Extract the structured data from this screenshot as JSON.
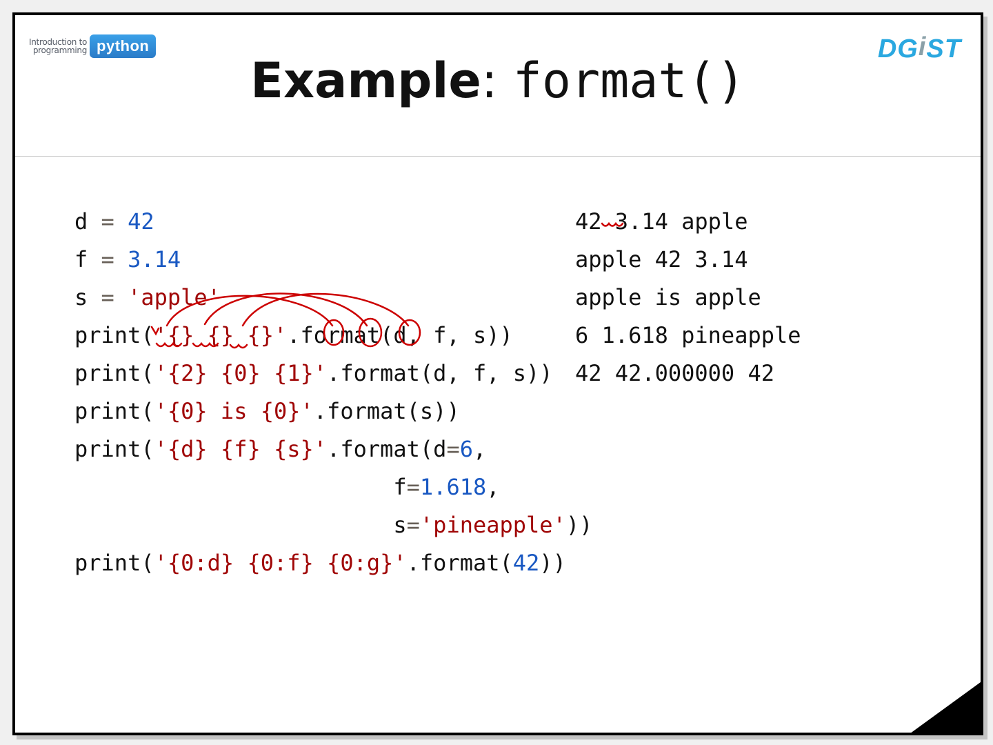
{
  "logos": {
    "left_small_line1": "Introduction to",
    "left_small_line2": "programming",
    "left_badge": "python",
    "right": "DGIST"
  },
  "title": {
    "prefix_bold": "Example",
    "colon": ": ",
    "mono": "format()"
  },
  "code": {
    "l1_a": "d ",
    "l1_eq": "=",
    "l1_b": " ",
    "l1_num": "42",
    "l2_a": "f ",
    "l2_eq": "=",
    "l2_b": " ",
    "l2_num": "3.14",
    "l3_a": "s ",
    "l3_eq": "=",
    "l3_b": " ",
    "l3_str": "'apple'",
    "l4_a": "print",
    "l4_p1": "(",
    "l4_s": "'{} {} {}'",
    "l4_dot": ".format(",
    "l4_args": "d, f, s",
    "l4_p2": "))",
    "l5_a": "print",
    "l5_p1": "(",
    "l5_s": "'{2} {0} {1}'",
    "l5_dot": ".format(",
    "l5_args": "d, f, s",
    "l5_p2": "))",
    "l6_a": "print",
    "l6_p1": "(",
    "l6_s1": "'{0} ",
    "l6_kw": "is",
    "l6_s2": " {0}'",
    "l6_dot": ".format(",
    "l6_args": "s",
    "l6_p2": "))",
    "l7_a": "print",
    "l7_p1": "(",
    "l7_s": "'{d} {f} {s}'",
    "l7_dot": ".format(",
    "l7_k1": "d",
    "l7_e1": "=",
    "l7_v1": "6",
    "l7_c1": ",",
    "l8_pad": "                        ",
    "l8_k": "f",
    "l8_e": "=",
    "l8_v": "1.618",
    "l8_c": ",",
    "l9_pad": "                        ",
    "l9_k": "s",
    "l9_e": "=",
    "l9_v": "'pineapple'",
    "l9_p": "))",
    "l10_a": "print",
    "l10_p1": "(",
    "l10_s": "'{0:d} {0:f} {0:g}'",
    "l10_dot": ".format(",
    "l10_v": "42",
    "l10_p2": "))"
  },
  "output": {
    "o1": "42 3.14 apple",
    "o2": "apple 42 3.14",
    "o3": "apple is apple",
    "o4": "6 1.618 pineapple",
    "o5": "42 42.000000 42"
  },
  "colors": {
    "number": "#1958c2",
    "string": "#a00606",
    "annotation": "#cc0000"
  }
}
